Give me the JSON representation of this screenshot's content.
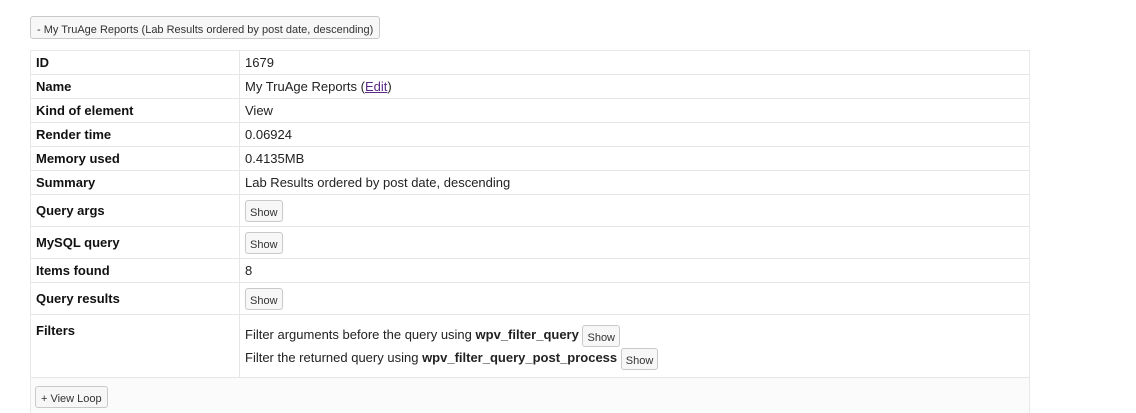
{
  "header": {
    "toggle_label": "- My TruAge Reports (Lab Results ordered by post date, descending)"
  },
  "details": {
    "id": {
      "label": "ID",
      "value": "1679"
    },
    "name": {
      "label": "Name",
      "value": "My TruAge Reports",
      "open_paren": "(",
      "edit_label": "Edit",
      "close_paren": ")"
    },
    "kind": {
      "label": "Kind of element",
      "value": "View"
    },
    "render_time": {
      "label": "Render time",
      "value": "0.06924"
    },
    "memory_used": {
      "label": "Memory used",
      "value": "0.4135MB"
    },
    "summary": {
      "label": "Summary",
      "value": "Lab Results ordered by post date, descending"
    },
    "query_args": {
      "label": "Query args",
      "button": "Show"
    },
    "mysql_query": {
      "label": "MySQL query",
      "button": "Show"
    },
    "items_found": {
      "label": "Items found",
      "value": "8"
    },
    "query_results": {
      "label": "Query results",
      "button": "Show"
    },
    "filters": {
      "label": "Filters",
      "line1_text": "Filter arguments before the query using",
      "line1_hook": "wpv_filter_query",
      "line1_button": "Show",
      "line2_text": "Filter the returned query using",
      "line2_hook": "wpv_filter_query_post_process",
      "line2_button": "Show"
    }
  },
  "footer": {
    "view_loop_label": "+ View Loop"
  }
}
